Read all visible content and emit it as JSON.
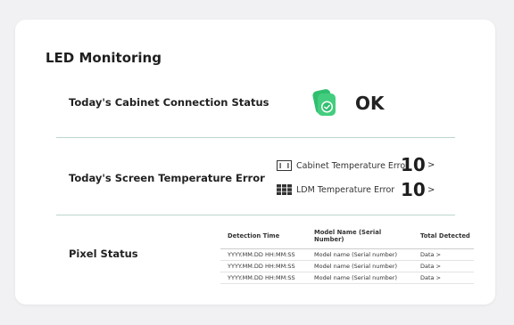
{
  "page": {
    "title": "LED Monitoring"
  },
  "connection": {
    "label": "Today's Cabinet Connection Status",
    "status": "OK",
    "icon": "cabinet-connected-icon"
  },
  "temperature": {
    "label": "Today's Screen Temperature Error",
    "rows": [
      {
        "label": "Cabinet Temperature Error",
        "value": "10",
        "chevron": ">",
        "icon": "cabinet-icon"
      },
      {
        "label": "LDM Temperature Error",
        "value": "10",
        "chevron": ">",
        "icon": "ldm-grid-icon"
      }
    ]
  },
  "pixel": {
    "label": "Pixel Status",
    "headers": [
      "Detection Time",
      "Model Name (Serial Number)",
      "Total Detected"
    ],
    "rows": [
      [
        "YYYY.MM.DD HH:MM:SS",
        "Model name (Serial number)",
        "Data >"
      ],
      [
        "YYYY.MM.DD HH:MM:SS",
        "Model name (Serial number)",
        "Data >"
      ],
      [
        "YYYY.MM.DD HH:MM:SS",
        "Model name (Serial number)",
        "Data >"
      ]
    ]
  },
  "colors": {
    "accent_green": "#2fbf6f",
    "divider": "#bcd6cc"
  }
}
